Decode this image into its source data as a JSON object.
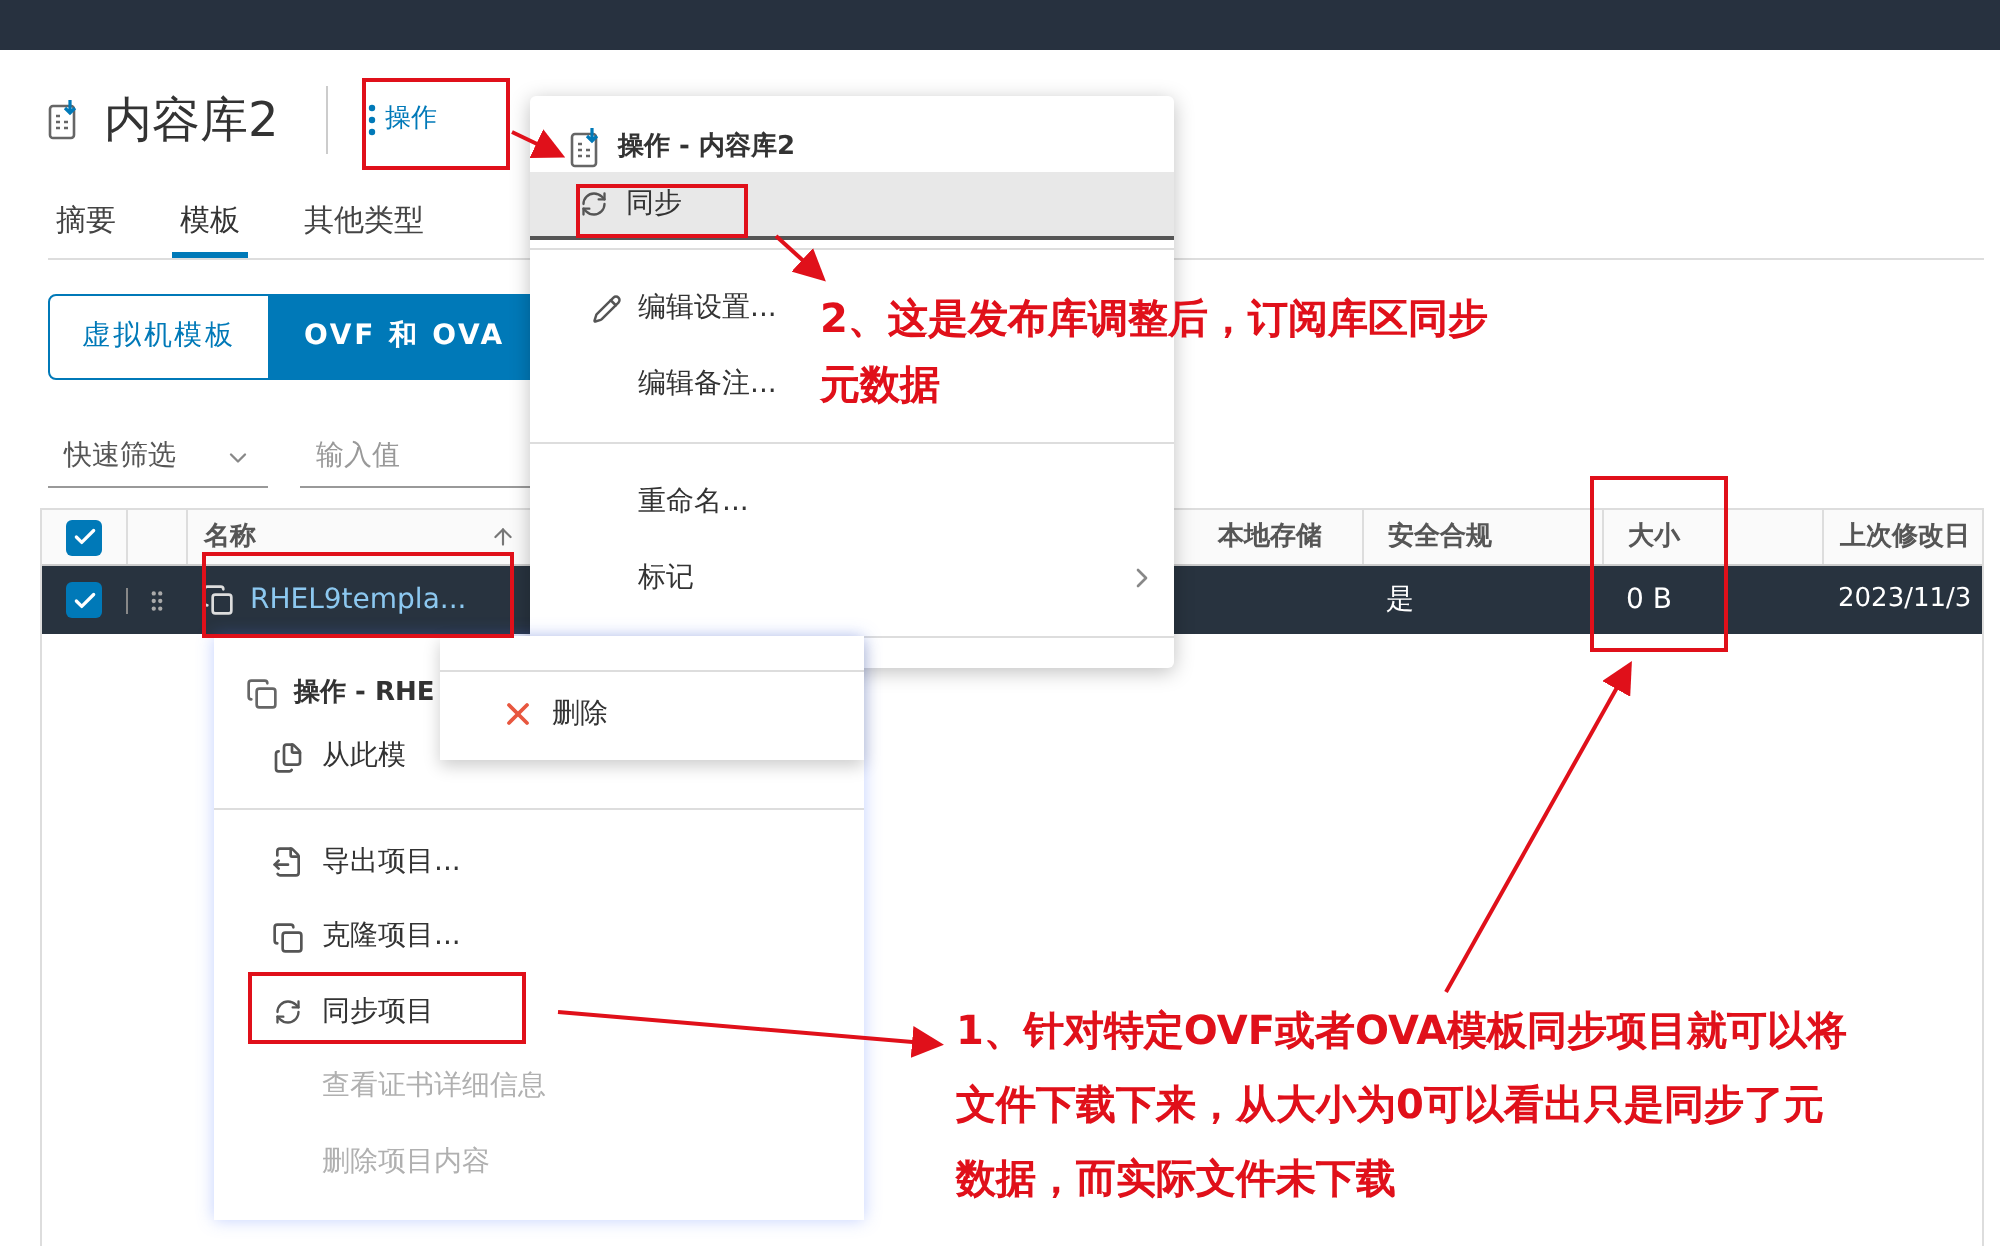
{
  "header": {
    "title": "内容库2",
    "actions_button": "操作"
  },
  "tabs": [
    {
      "label": "摘要",
      "selected": false
    },
    {
      "label": "模板",
      "selected": true
    },
    {
      "label": "其他类型",
      "selected": false
    }
  ],
  "segments": [
    {
      "label": "虚拟机模板",
      "selected": false
    },
    {
      "label": "OVF 和 OVA",
      "selected": true
    }
  ],
  "filter": {
    "dropdown": "快速筛选",
    "placeholder": "输入值"
  },
  "table": {
    "select_all_checked": true,
    "columns": [
      "名称",
      "本地存储",
      "安全合规",
      "大小",
      "上次修改日"
    ],
    "rows": [
      {
        "checked": true,
        "selected": true,
        "name": "RHEL9templa...",
        "compliance": "是",
        "size": "0 B",
        "modified": "2023/11/3"
      }
    ]
  },
  "library_menu": {
    "title": "操作 - 内容库2",
    "groups": [
      [
        {
          "label": "同步",
          "kind": "sync",
          "highlighted": true,
          "submenu": false
        }
      ],
      [
        {
          "label": "编辑设置...",
          "kind": "pencil",
          "highlighted": false,
          "submenu": false
        },
        {
          "label": "编辑备注...",
          "kind": "plain",
          "highlighted": false,
          "submenu": false
        }
      ],
      [
        {
          "label": "重命名...",
          "kind": "plain",
          "highlighted": false,
          "submenu": false
        },
        {
          "label": "标记",
          "kind": "plain",
          "highlighted": false,
          "submenu": true
        }
      ]
    ]
  },
  "item_menu": {
    "title": "操作 - RHE",
    "groups": [
      [
        {
          "label": "从此模",
          "kind": "new-vm",
          "disabled": false
        }
      ],
      [
        {
          "label": "导出项目...",
          "kind": "export",
          "disabled": false
        },
        {
          "label": "克隆项目...",
          "kind": "clone",
          "disabled": false
        },
        {
          "label": "同步项目",
          "kind": "sync",
          "disabled": false
        },
        {
          "label": "查看证书详细信息",
          "kind": "plain",
          "disabled": true
        },
        {
          "label": "删除项目内容",
          "kind": "plain",
          "disabled": true
        }
      ]
    ]
  },
  "delete_popup": {
    "label": "删除"
  },
  "annotations": [
    {
      "text": "2、这是发布库调整后，订阅库区同步元数据"
    },
    {
      "text": "1、针对特定OVF或者OVA模板同步项目就可以将文件下载下来，从大小为0可以看出只是同步了元数据，而实际文件未下载"
    }
  ]
}
